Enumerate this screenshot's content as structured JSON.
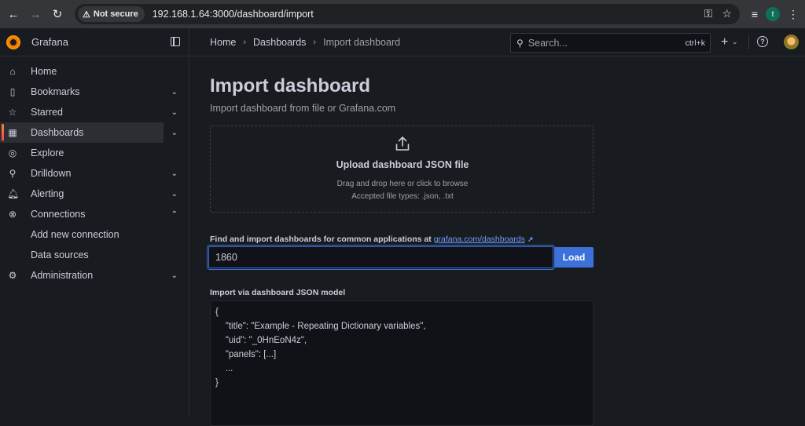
{
  "browser": {
    "security_label": "Not secure",
    "url": "192.168.1.64:3000/dashboard/import",
    "profile_initial": "t"
  },
  "app": {
    "name": "Grafana"
  },
  "sidebar": {
    "items": [
      {
        "label": "Home",
        "icon": "home-icon",
        "chevron": ""
      },
      {
        "label": "Bookmarks",
        "icon": "bookmark-icon",
        "chevron": "⌄"
      },
      {
        "label": "Starred",
        "icon": "star-icon",
        "chevron": "⌄"
      },
      {
        "label": "Dashboards",
        "icon": "dashboards-grid-icon",
        "chevron": "⌄"
      },
      {
        "label": "Explore",
        "icon": "compass-icon",
        "chevron": ""
      },
      {
        "label": "Drilldown",
        "icon": "drilldown-icon",
        "chevron": "⌄"
      },
      {
        "label": "Alerting",
        "icon": "bell-icon",
        "chevron": "⌄"
      },
      {
        "label": "Connections",
        "icon": "connections-icon",
        "chevron": "⌃"
      },
      {
        "label": "Add new connection",
        "icon": "",
        "chevron": ""
      },
      {
        "label": "Data sources",
        "icon": "",
        "chevron": ""
      },
      {
        "label": "Administration",
        "icon": "gear-icon",
        "chevron": "⌄"
      }
    ]
  },
  "topbar": {
    "breadcrumbs": [
      "Home",
      "Dashboards",
      "Import dashboard"
    ],
    "search_placeholder": "Search...",
    "search_shortcut": "ctrl+k"
  },
  "page": {
    "title": "Import dashboard",
    "subtitle": "Import dashboard from file or Grafana.com",
    "upload": {
      "title": "Upload dashboard JSON file",
      "hint": "Drag and drop here or click to browse",
      "accepted": "Accepted file types: .json, .txt"
    },
    "find": {
      "label": "Find and import dashboards for common applications at",
      "link_text": "grafana.com/dashboards",
      "input_value": "1860",
      "load_label": "Load"
    },
    "json_model": {
      "label": "Import via dashboard JSON model",
      "lines": [
        "{",
        "    \"title\": \"Example - Repeating Dictionary variables\",",
        "    \"uid\": \"_0HnEoN4z\",",
        "    \"panels\": [...]",
        "    ...",
        "}"
      ]
    }
  },
  "colors": {
    "accent": "#3d71d9",
    "active_indicator": "#ff8833",
    "link": "#6e9fff"
  }
}
